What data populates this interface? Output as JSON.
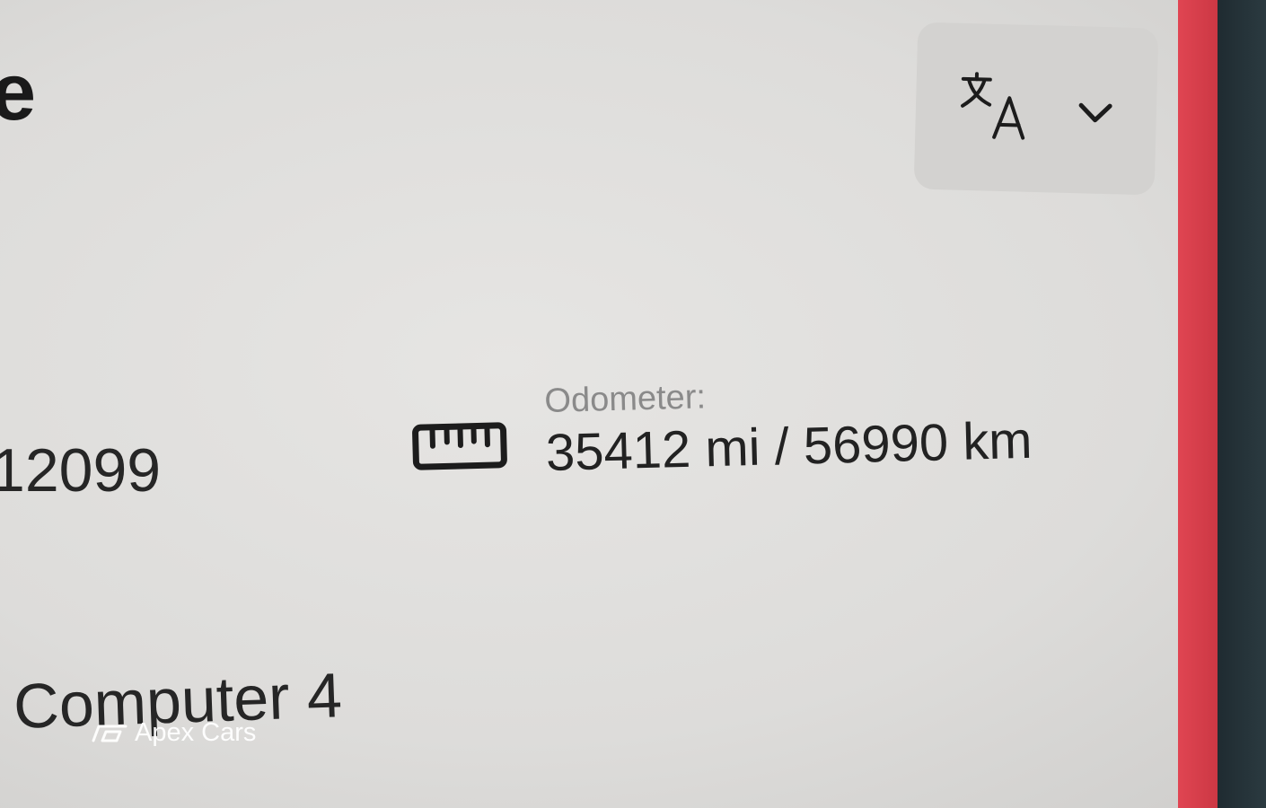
{
  "header": {
    "title_fragment": "e"
  },
  "language_selector": {
    "icon": "translate-icon",
    "dropdown_icon": "chevron-down-icon"
  },
  "details": {
    "left_value": "12099",
    "odometer": {
      "icon": "ruler-icon",
      "label": "Odometer:",
      "value": "35412 mi / 56990 km"
    },
    "computer": "Computer 4"
  },
  "watermark": {
    "text": "Apex Cars"
  },
  "colors": {
    "screen_background": "#dddcda",
    "bezel_red": "#d93d49",
    "bezel_dark": "#243238",
    "label_gray": "#8a8a8a"
  }
}
